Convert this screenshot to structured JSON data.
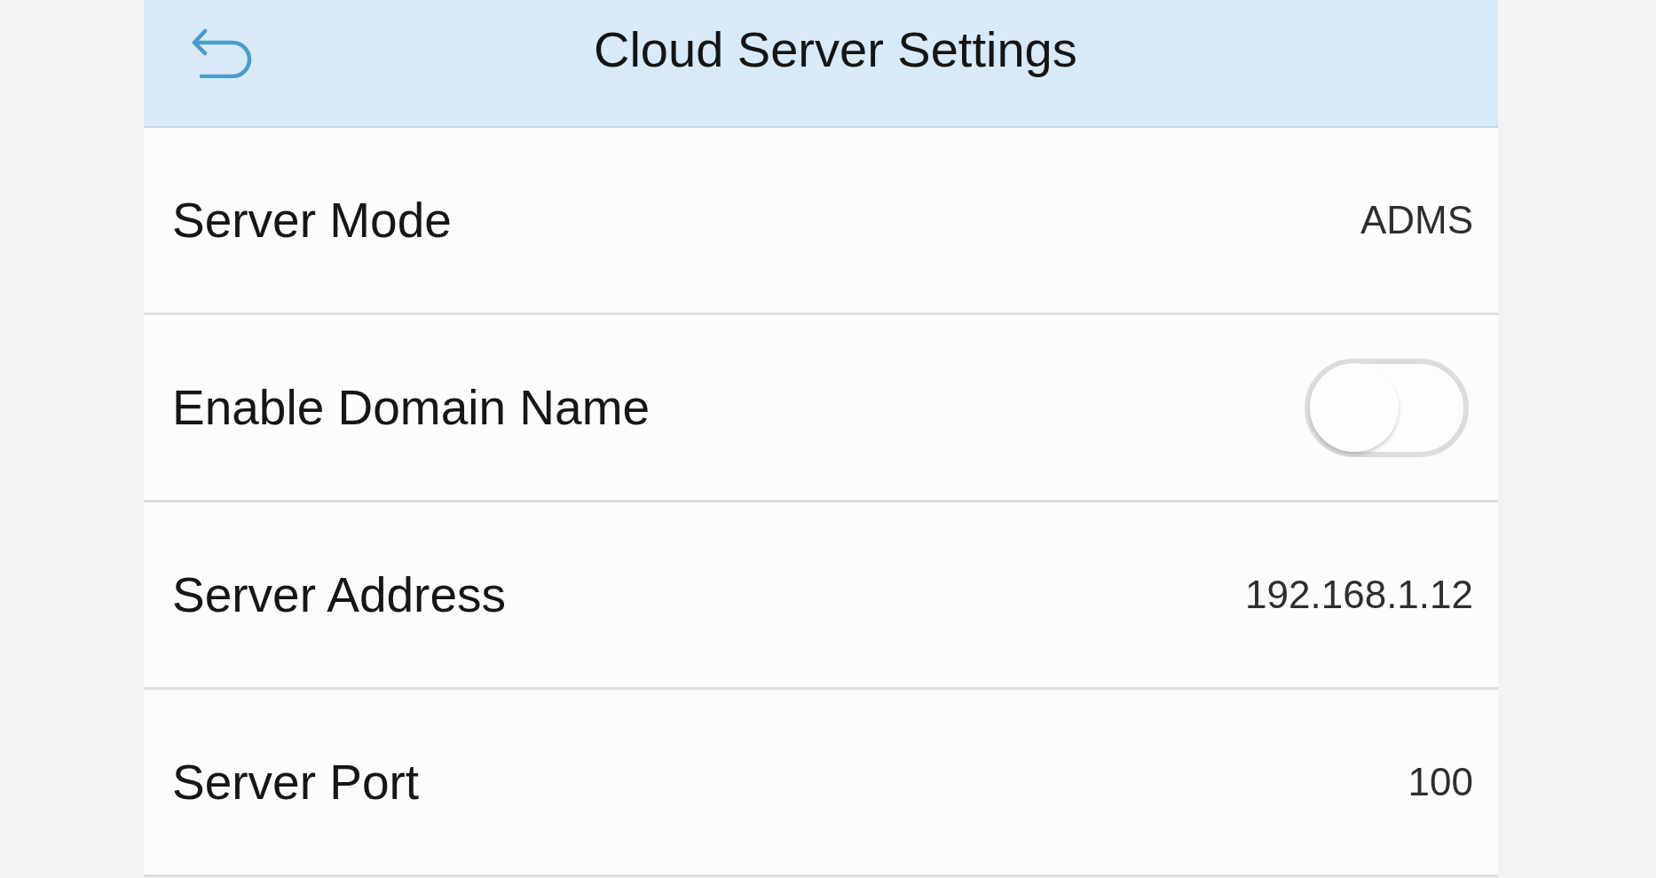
{
  "header": {
    "title": "Cloud Server Settings"
  },
  "settings": [
    {
      "kind": "value",
      "label": "Server Mode",
      "value": "ADMS"
    },
    {
      "kind": "switch",
      "label": "Enable Domain Name",
      "on": false
    },
    {
      "kind": "value",
      "label": "Server Address",
      "value": "192.168.1.12"
    },
    {
      "kind": "value",
      "label": "Server Port",
      "value": "100"
    }
  ]
}
